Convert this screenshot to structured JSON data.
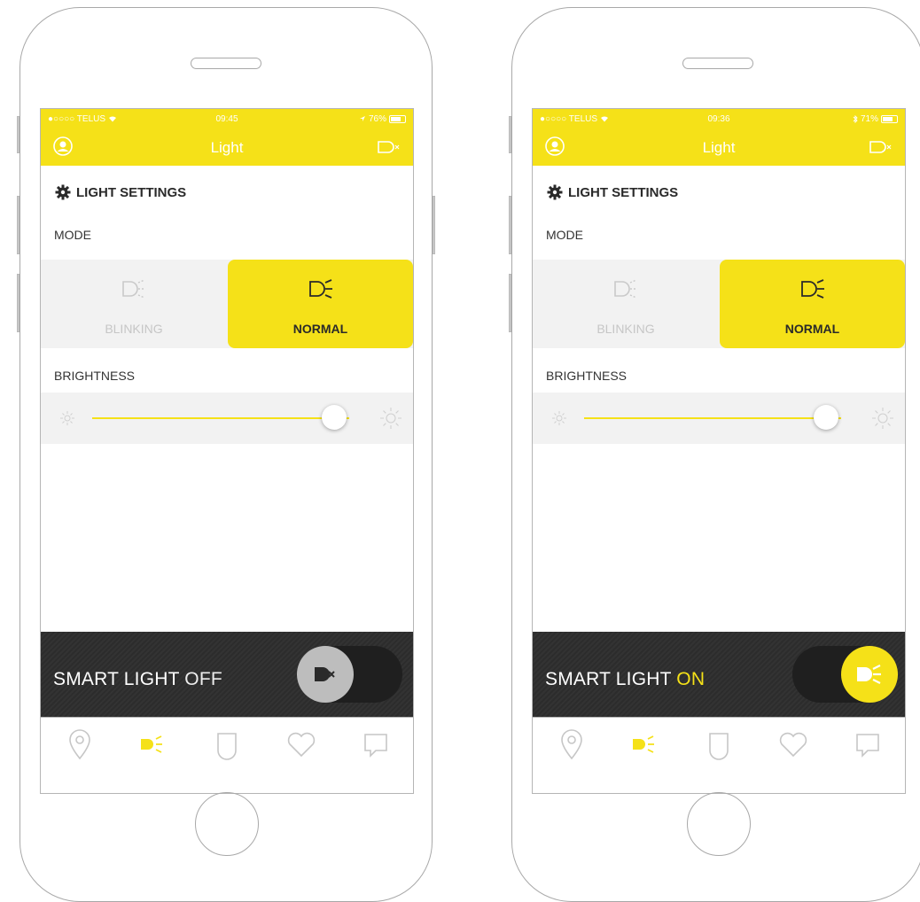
{
  "colors": {
    "brand_yellow": "#f5e118",
    "dark_bar": "#2f2f2f",
    "panel_gray": "#f2f2f2",
    "inactive_text": "#c6c6c6",
    "knob_gray": "#bdbdbd"
  },
  "screens": [
    {
      "status": {
        "carrier": "●○○○○ TELUS",
        "time": "09:45",
        "battery": "76%",
        "battery_fill": 0.76
      },
      "nav": {
        "title": "Light",
        "left_icon": "profile-icon",
        "right_icon": "device-disconnected-icon"
      },
      "settings": {
        "header": "LIGHT SETTINGS",
        "mode_label": "MODE",
        "modes": [
          {
            "label": "BLINKING",
            "icon": "blinking-light-icon",
            "selected": false
          },
          {
            "label": "NORMAL",
            "icon": "normal-light-icon",
            "selected": true
          }
        ],
        "brightness_label": "BRIGHTNESS",
        "brightness_value": 0.94
      },
      "smart_light": {
        "label": "SMART LIGHT",
        "state": "OFF",
        "on": false
      },
      "tabs": [
        {
          "name": "location",
          "icon": "location-pin-icon",
          "active": false
        },
        {
          "name": "light",
          "icon": "headlight-icon",
          "active": true
        },
        {
          "name": "security",
          "icon": "shield-icon",
          "active": false
        },
        {
          "name": "favorites",
          "icon": "heart-icon",
          "active": false
        },
        {
          "name": "messages",
          "icon": "chat-bubble-icon",
          "active": false
        }
      ]
    },
    {
      "status": {
        "carrier": "●○○○○ TELUS",
        "time": "09:36",
        "battery": "71%",
        "battery_fill": 0.71
      },
      "nav": {
        "title": "Light",
        "left_icon": "profile-icon",
        "right_icon": "device-disconnected-icon"
      },
      "settings": {
        "header": "LIGHT SETTINGS",
        "mode_label": "MODE",
        "modes": [
          {
            "label": "BLINKING",
            "icon": "blinking-light-icon",
            "selected": false
          },
          {
            "label": "NORMAL",
            "icon": "normal-light-icon",
            "selected": true
          }
        ],
        "brightness_label": "BRIGHTNESS",
        "brightness_value": 0.94
      },
      "smart_light": {
        "label": "SMART LIGHT",
        "state": "ON",
        "on": true
      },
      "tabs": [
        {
          "name": "location",
          "icon": "location-pin-icon",
          "active": false
        },
        {
          "name": "light",
          "icon": "headlight-icon",
          "active": true
        },
        {
          "name": "security",
          "icon": "shield-icon",
          "active": false
        },
        {
          "name": "favorites",
          "icon": "heart-icon",
          "active": false
        },
        {
          "name": "messages",
          "icon": "chat-bubble-icon",
          "active": false
        }
      ]
    }
  ]
}
